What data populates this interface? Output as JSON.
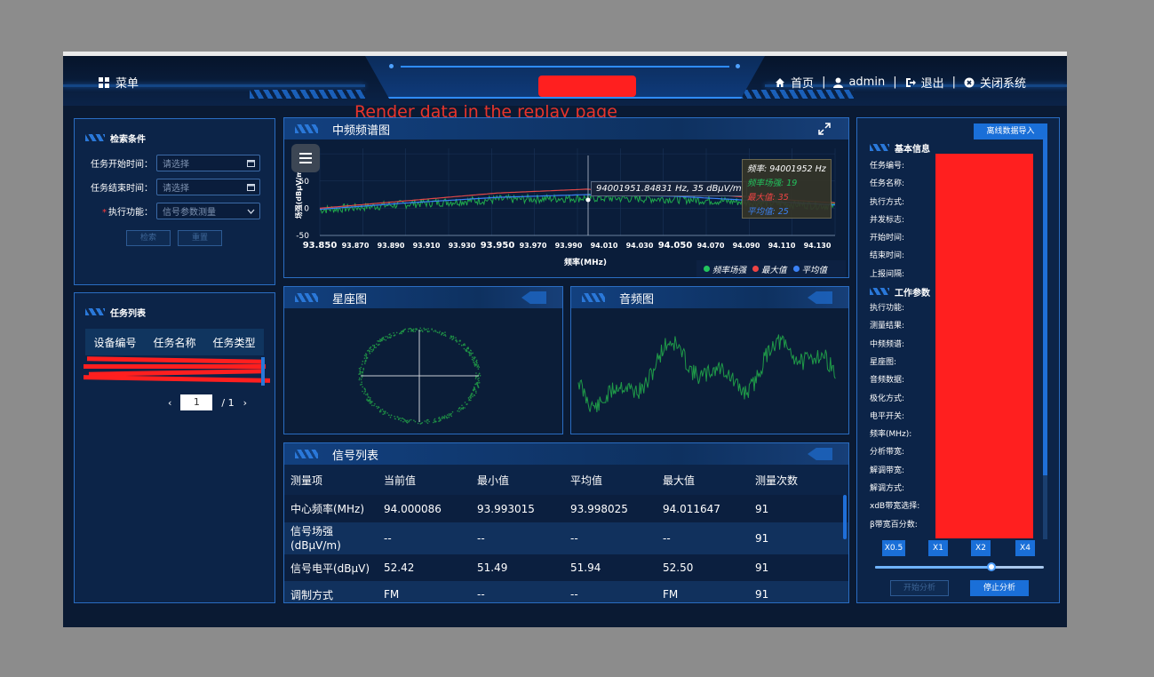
{
  "header": {
    "menu_label": "菜单",
    "nav": {
      "home": "首页",
      "user": "admin",
      "logout": "退出",
      "close_system": "关闭系统",
      "separator": "|"
    }
  },
  "overlay_text": "Render data in the replay page",
  "search_panel": {
    "title": "检索条件",
    "start_label": "任务开始时间：",
    "start_placeholder": "请选择",
    "end_label": "任务结束时间：",
    "end_placeholder": "请选择",
    "function_required_mark": "*",
    "function_label": "执行功能：",
    "function_value": "信号参数测量",
    "search_button": "检索",
    "reset_button": "重置"
  },
  "task_panel": {
    "title": "任务列表",
    "columns": [
      "设备编号",
      "任务名称",
      "任务类型"
    ],
    "page_current": "1",
    "page_total": "/ 1"
  },
  "spectrum": {
    "title": "中频频谱图",
    "tooltip_crosshair": "94001951.84831 Hz, 35 dBμV/m",
    "tooltip": {
      "freq": "频率: 94001952 Hz",
      "strength": "频率场强: 19",
      "max": "最大值: 35",
      "avg": "平均值: 25"
    },
    "colors": {
      "strength": "#22c55e",
      "max": "#ef4444",
      "avg": "#3b82f6"
    }
  },
  "chart_data": {
    "type": "line",
    "xlabel": "频率(MHz)",
    "ylabel": "场强(dBμV/m)",
    "x_ticks_major": [
      "93.850",
      "93.950",
      "94.050"
    ],
    "x_ticks": [
      "93.850",
      "93.870",
      "93.890",
      "93.910",
      "93.930",
      "93.950",
      "93.970",
      "93.990",
      "94.010",
      "94.030",
      "94.050",
      "94.070",
      "94.090",
      "94.110",
      "94.130"
    ],
    "y_ticks": [
      "100",
      "50",
      "0",
      "-50"
    ],
    "xlim": [
      93.85,
      94.14
    ],
    "ylim": [
      -50,
      110
    ],
    "legend_position": "bottom-right",
    "series": [
      {
        "name": "频率场强",
        "x": [
          93.85,
          93.9,
          93.95,
          94.0,
          94.05,
          94.1,
          94.14
        ],
        "values": [
          -3,
          8,
          16,
          19,
          17,
          10,
          4
        ]
      },
      {
        "name": "最大值",
        "x": [
          93.85,
          93.9,
          93.95,
          94.0,
          94.05,
          94.1,
          94.14
        ],
        "values": [
          0,
          14,
          28,
          35,
          30,
          18,
          10
        ]
      },
      {
        "name": "平均值",
        "x": [
          93.85,
          93.9,
          93.95,
          94.0,
          94.05,
          94.1,
          94.14
        ],
        "values": [
          -2,
          10,
          20,
          25,
          22,
          13,
          6
        ]
      }
    ]
  },
  "constellation": {
    "title": "星座图"
  },
  "audio": {
    "title": "音频图"
  },
  "signal_list": {
    "title": "信号列表",
    "columns": [
      "测量项",
      "当前值",
      "最小值",
      "平均值",
      "最大值",
      "测量次数"
    ],
    "rows": [
      [
        "中心频率(MHz)",
        "94.000086",
        "93.993015",
        "93.998025",
        "94.011647",
        "91"
      ],
      [
        "信号场强\n(dBμV/m)",
        "--",
        "--",
        "--",
        "--",
        "91"
      ],
      [
        "信号电平(dBμV)",
        "52.42",
        "51.49",
        "51.94",
        "52.50",
        "91"
      ],
      [
        "调制方式",
        "FM",
        "--",
        "--",
        "FM",
        "91"
      ]
    ]
  },
  "right_panel": {
    "import_button": "离线数据导入",
    "basic_title": "基本信息",
    "basic_fields": [
      "任务编号:",
      "任务名称:",
      "执行方式:",
      "并发标志:",
      "开始时间:",
      "结束时间:",
      "上报间隔:"
    ],
    "work_title": "工作参数",
    "work_fields": [
      "执行功能:",
      "测量结果:",
      "中频频谱:",
      "星座图:",
      "音频数据:",
      "极化方式:",
      "电平开关:",
      "频率(MHz):",
      "分析带宽:",
      "解调带宽:",
      "解调方式:",
      "xdB带宽选择:",
      "β带宽百分数:"
    ],
    "speeds": [
      "X0.5",
      "X1",
      "X2",
      "X4"
    ],
    "playback_fraction": 0.69,
    "start_button": "开始分析",
    "stop_button": "停止分析"
  }
}
